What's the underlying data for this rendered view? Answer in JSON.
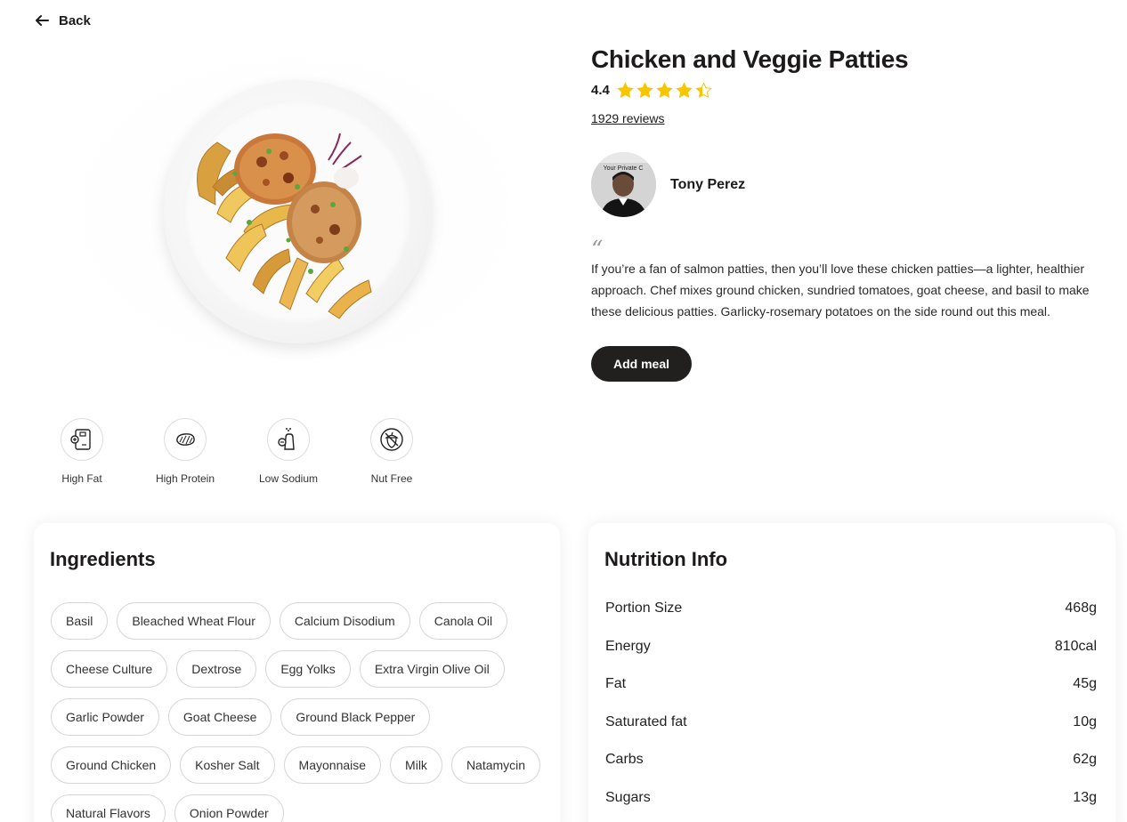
{
  "nav": {
    "back_label": "Back"
  },
  "meal": {
    "title": "Chicken and Veggie Patties",
    "rating": "4.4",
    "rating_value": 4.4,
    "rating_max": 5,
    "reviews": "1929 reviews",
    "chef_name": "Tony Perez",
    "avatar_caption": "Your Private C",
    "quote_mark": "“",
    "description": "If you’re a fan of salmon patties, then you’ll love these chicken patties—a lighter, healthier approach. Chef mixes ground chicken, sundried tomatoes, goat cheese, and basil to make these delicious patties. Garlicky-rosemary potatoes on the side round out this meal.",
    "add_label": "Add meal"
  },
  "tags": [
    {
      "label": "High Fat",
      "icon": "scale-plus-icon"
    },
    {
      "label": "High Protein",
      "icon": "steak-icon"
    },
    {
      "label": "Low Sodium",
      "icon": "salt-shaker-icon"
    },
    {
      "label": "Nut Free",
      "icon": "acorn-crossed-icon"
    }
  ],
  "ingredients": {
    "title": "Ingredients",
    "items": [
      "Basil",
      "Bleached Wheat Flour",
      "Calcium Disodium",
      "Canola Oil",
      "Cheese Culture",
      "Dextrose",
      "Egg Yolks",
      "Extra Virgin Olive Oil",
      "Garlic Powder",
      "Goat Cheese",
      "Ground Black Pepper",
      "Ground Chicken",
      "Kosher Salt",
      "Mayonnaise",
      "Milk",
      "Natamycin",
      "Natural Flavors",
      "Onion Powder"
    ]
  },
  "nutrition": {
    "title": "Nutrition Info",
    "rows": [
      {
        "label": "Portion Size",
        "value": "468g"
      },
      {
        "label": "Energy",
        "value": "810cal"
      },
      {
        "label": "Fat",
        "value": "45g"
      },
      {
        "label": "Saturated fat",
        "value": "10g"
      },
      {
        "label": "Carbs",
        "value": "62g"
      },
      {
        "label": "Sugars",
        "value": "13g"
      }
    ]
  },
  "colors": {
    "star": "#f7c600",
    "button": "#221f1f",
    "text": "#1c1a1a"
  }
}
